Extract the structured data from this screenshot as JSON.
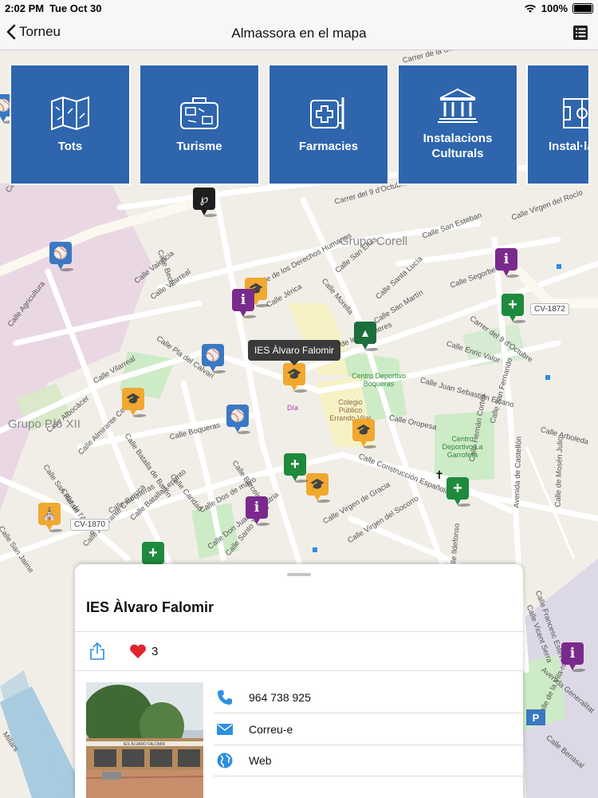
{
  "status": {
    "time": "2:02 PM",
    "date": "Tue Oct 30",
    "battery": "100%"
  },
  "nav": {
    "back_label": "Torneu",
    "title": "Almassora en el mapa"
  },
  "categories": [
    {
      "label": "Tots",
      "icon": "map-icon"
    },
    {
      "label": "Turisme",
      "icon": "suitcase-icon"
    },
    {
      "label": "Farmacies",
      "icon": "pharmacy-sign-icon"
    },
    {
      "label": "Instalacions Culturals",
      "icon": "museum-icon"
    },
    {
      "label": "Instal·la Espor",
      "icon": "sports-field-icon"
    }
  ],
  "map": {
    "places": [
      "Grupo Corell",
      "Grupo Pío XII"
    ],
    "road_shields": [
      "CV-1872",
      "CV-1870"
    ],
    "poi_labels": [
      "Centro Deportivo Boqueras",
      "Colegio Público Errando Vilar",
      "Centro Deportivo La Garrofera",
      "Día"
    ],
    "streets": [
      "Carrer de la Unión",
      "Carrer del 9 d'Octubre",
      "Calle San Esteban",
      "Calle Virgen del Rocío",
      "Calle de los Derechos Humanos",
      "Calle San Elías",
      "Calle Santa Lucía",
      "Calle Segorbe",
      "Calle Jérica",
      "Calle Morella",
      "Calle San Martín",
      "Carrer de les Boqueres",
      "Carrer del 9 d'Octubre",
      "Calle Enric Valor",
      "Calle Juan Sebastián Elcano",
      "Calle Oropesa",
      "Calle Arboleda",
      "Calle San Fernando",
      "Calle Construcción Española",
      "Calle Hernán Cortés",
      "Avenida de Castellón",
      "Calle de Mosén Julio",
      "Calle Valencia",
      "Calle Bechí",
      "Calle Vilarreal",
      "Calle Agricultura",
      "Calle Pla del Calvari",
      "Calle Vilarreal",
      "Calle Albocàcer",
      "Calle Almirante Cervera",
      "Calle San Rafael",
      "Calle Batalla de Bailén",
      "Calle Boqueras",
      "Calle Barcelona",
      "Calle Caridad",
      "Calle Dos de mayo",
      "Calle Virgen de Gracia",
      "Calle Virgen del Socorro",
      "Calle Santo Tomás",
      "Calle Don Juan de Austria",
      "Calle Boqueras",
      "Calle Batalla Lepanto",
      "Calle Almirante Churruca",
      "Calle de l'Alcora",
      "Calle San Jaime",
      "Calle Onda",
      "Avenida Generalitat",
      "Calle Vicent Serra",
      "Calle Francesc Esteve",
      "Calle Benasal",
      "Calle de la Vila-roja",
      "Millars",
      "Calle Ildefonso"
    ],
    "tooltip": "IES Àlvaro Falomir"
  },
  "detail": {
    "title": "IES Àlvaro Falomir",
    "likes": "3",
    "contacts": [
      {
        "label": "964 738 925",
        "icon": "phone-icon"
      },
      {
        "label": "Correu-e",
        "icon": "mail-icon"
      },
      {
        "label": "Web",
        "icon": "globe-icon"
      }
    ],
    "photo_sign": "IES ÀLVARO FALOMIR"
  },
  "colors": {
    "category_blue": "#2e65ad",
    "education_pin": "#f0a830",
    "sports_pin": "#3a78c3",
    "info_pin": "#7a2a8c",
    "pharmacy_pin": "#1e8a3c",
    "heart": "#e0242e",
    "icon_blue": "#2d8ee0"
  }
}
